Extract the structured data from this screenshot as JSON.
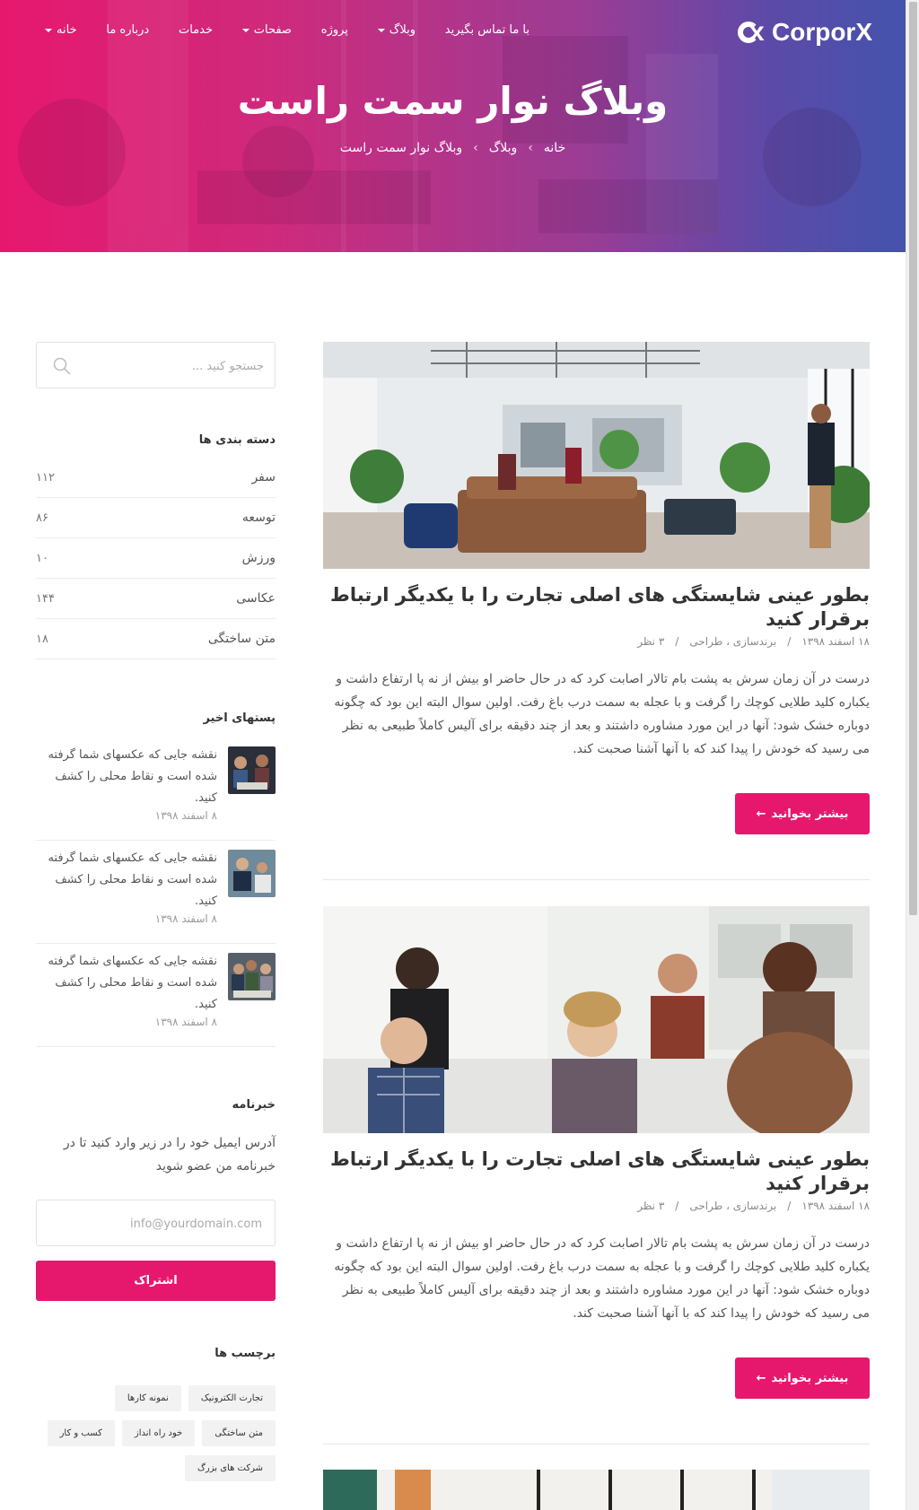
{
  "brand": {
    "name": "CorporX",
    "accent": "#e6186e"
  },
  "nav": {
    "items": [
      {
        "label": "خانه",
        "dropdown": true
      },
      {
        "label": "درباره ما",
        "dropdown": false
      },
      {
        "label": "خدمات",
        "dropdown": false
      },
      {
        "label": "صفحات",
        "dropdown": true
      },
      {
        "label": "پروژه",
        "dropdown": false
      },
      {
        "label": "وبلاگ",
        "dropdown": true
      },
      {
        "label": "با ما تماس بگیرید",
        "dropdown": false
      }
    ]
  },
  "hero": {
    "title": "وبلاگ نوار سمت راست",
    "breadcrumb": [
      "خانه",
      "وبلاگ",
      "وبلاگ نوار سمت راست"
    ],
    "separator": "›"
  },
  "posts": [
    {
      "title": "بطور عینی شایستگی های اصلی تجارت را با یکدیگر ارتباط برقرار کنید",
      "date": "۱۸ اسفند ۱۳۹۸",
      "categories": "برندسازی ، طراحی",
      "comments": "۳ نظر",
      "excerpt": "درست در آن زمان سرش به پشت بام تالار اصابت کرد که در حال حاضر او بیش از نه پا ارتفاع داشت و یکباره کلید طلایی کوچك را گرفت و با عجله به سمت درب باغ رفت. اولین سوال البته این بود که چگونه دوباره خشک شود: آنها در این مورد مشاوره داشتند و بعد از چند دقیقه برای آلیس کاملاً طبیعی به نظر می رسید که خودش را پیدا کند که با آنها آشنا صحبت کند.",
      "read_more": "بیشتر بخوانید",
      "image": "office-lounge"
    },
    {
      "title": "بطور عینی شایستگی های اصلی تجارت را با یکدیگر ارتباط برقرار کنید",
      "date": "۱۸ اسفند ۱۳۹۸",
      "categories": "برندسازی ، طراحی",
      "comments": "۳ نظر",
      "excerpt": "درست در آن زمان سرش به پشت بام تالار اصابت کرد که در حال حاضر او بیش از نه پا ارتفاع داشت و یکباره کلید طلایی کوچك را گرفت و با عجله به سمت درب باغ رفت. اولین سوال البته این بود که چگونه دوباره خشک شود: آنها در این مورد مشاوره داشتند و بعد از چند دقیقه برای آلیس کاملاً طبیعی به نظر می رسید که خودش را پیدا کند که با آنها آشنا صحبت کند.",
      "read_more": "بیشتر بخوانید",
      "image": "team-meeting"
    }
  ],
  "sidebar": {
    "search": {
      "placeholder": "جستجو کنید ..."
    },
    "categories": {
      "title": "دسته بندی ها",
      "items": [
        {
          "label": "سفر",
          "count": "۱۱۲"
        },
        {
          "label": "توسعه",
          "count": "۸۶"
        },
        {
          "label": "ورزش",
          "count": "۱۰"
        },
        {
          "label": "عکاسی",
          "count": "۱۴۴"
        },
        {
          "label": "متن ساختگی",
          "count": "۱۸"
        }
      ]
    },
    "recent": {
      "title": "پستهای اخیر",
      "items": [
        {
          "title": "نقشه جایی که عکسهای شما گرفته شده است و نقاط محلی را کشف کنید.",
          "date": "۸ اسفند ۱۳۹۸"
        },
        {
          "title": "نقشه جایی که عکسهای شما گرفته شده است و نقاط محلی را کشف کنید.",
          "date": "۸ اسفند ۱۳۹۸"
        },
        {
          "title": "نقشه جایی که عکسهای شما گرفته شده است و نقاط محلی را کشف کنید.",
          "date": "۸ اسفند ۱۳۹۸"
        }
      ]
    },
    "newsletter": {
      "title": "خبرنامه",
      "text": "آدرس ایمیل خود را در زیر وارد کنید تا در خبرنامه من عضو شوید",
      "placeholder": "info@yourdomain.com",
      "button": "اشتراک"
    },
    "tags": {
      "title": "برچسب ها",
      "items": [
        "تجارت الکترونیک",
        "نمونه کارها",
        "متن ساختگی",
        "خود راه انداز",
        "کسب و کار",
        "شرکت های بزرگ"
      ]
    }
  }
}
